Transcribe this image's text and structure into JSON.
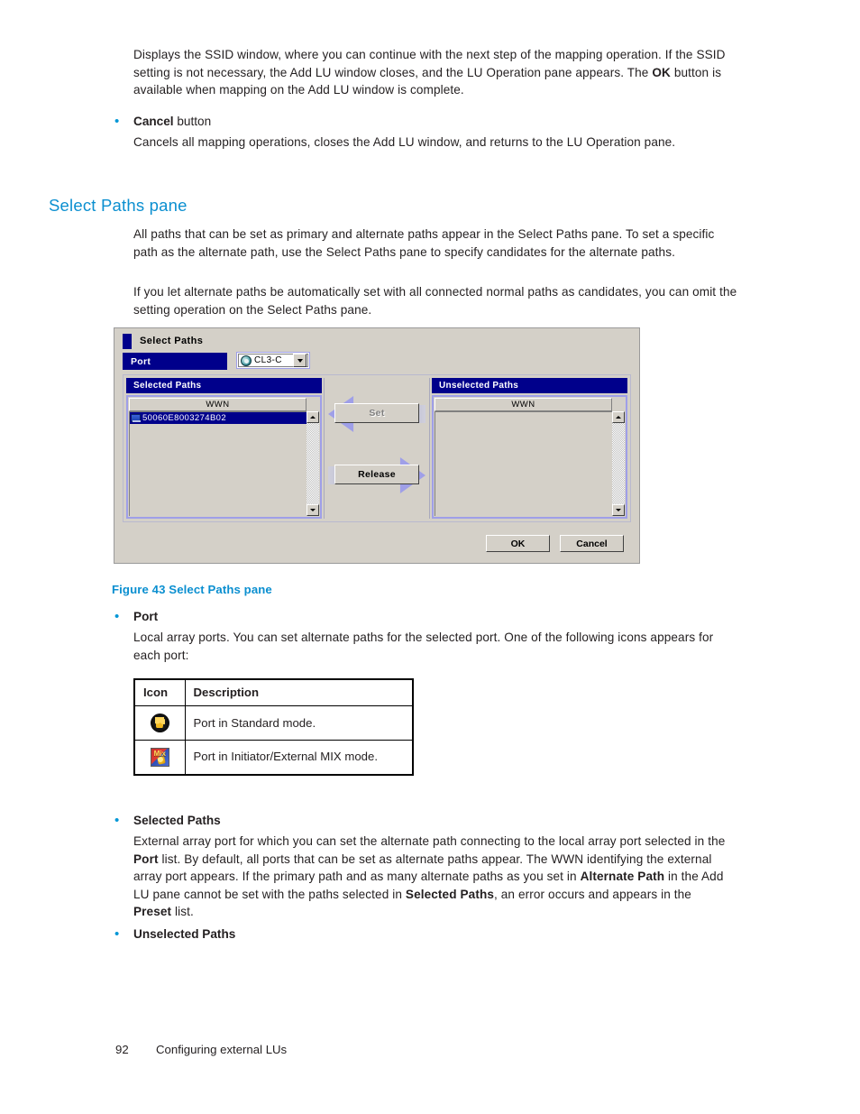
{
  "document": {
    "intro": {
      "para1": "Displays the SSID window, where you can continue with the next step of the mapping operation. If the SSID setting is not necessary, the Add LU window closes, and the LU Operation pane appears. The ",
      "para1_bold": "OK",
      "para1_cont": " button is available when mapping on the Add LU window is complete.",
      "cancel_bullet_bold": "Cancel",
      "cancel_bullet_rest": " button",
      "cancel_desc": "Cancels all mapping operations, closes the Add LU window, and returns to the LU Operation pane."
    },
    "section": {
      "heading": "Select Paths pane",
      "para1": "All paths that can be set as primary and alternate paths appear in the Select Paths pane. To set a specific path as the alternate path, use the Select Paths pane to specify candidates for the alternate paths.",
      "para2": "If you let alternate paths be automatically set with all connected normal paths as candidates, you can omit the setting operation on the Select Paths pane."
    },
    "figure_caption": "Figure 43 Select Paths pane",
    "bullets": {
      "port": {
        "title": "Port",
        "desc": "Local array ports. You can set alternate paths for the selected port. One of the following icons appears for each port:"
      },
      "selected_paths": {
        "title": "Selected Paths",
        "t1": "External array port for which you can set the alternate path connecting to the local array port selected in the ",
        "b1": "Port",
        "t2": " list. By default, all ports that can be set as alternate paths appear. The WWN identifying the external array port appears. If the primary path and as many alternate paths as you set in ",
        "b2": "Alternate Path",
        "t3": " in the Add LU pane cannot be set with the paths selected in ",
        "b3": "Selected Paths",
        "t4": ", an error occurs and appears in the ",
        "b4": "Preset",
        "t5": " list."
      },
      "unselected_paths": {
        "title": "Unselected Paths"
      }
    },
    "icon_table": {
      "headers": {
        "icon": "Icon",
        "description": "Description"
      },
      "rows": [
        {
          "icon_name": "port-standard-mode-icon",
          "description": "Port in Standard mode."
        },
        {
          "icon_name": "port-initiator-external-mix-mode-icon",
          "description": "Port in Initiator/External MIX mode."
        }
      ]
    },
    "footer": {
      "page_number": "92",
      "chapter": "Configuring external LUs"
    }
  },
  "figure": {
    "dialog": {
      "title": "Select Paths",
      "port": {
        "label": "Port",
        "selected_value": "CL3-C",
        "icon_name": "port-standard-mode-icon"
      },
      "selected_paths_panel": {
        "title": "Selected Paths",
        "column_header": "WWN",
        "rows": [
          {
            "wwn": "50060E8003274B02",
            "selected": "true"
          }
        ]
      },
      "unselected_paths_panel": {
        "title": "Unselected Paths",
        "column_header": "WWN",
        "rows": []
      },
      "transfer_buttons": {
        "set": "Set",
        "set_state": "disabled",
        "release": "Release",
        "release_state": "enabled"
      },
      "footer_buttons": {
        "ok": "OK",
        "cancel": "Cancel"
      }
    }
  },
  "colors": {
    "heading_blue": "#0b8fd0",
    "bullet_blue": "#0096d6",
    "dialog_navy": "#00008b",
    "dialog_face": "#d4d0c8",
    "arrow_violet": "#9f9fe8"
  }
}
